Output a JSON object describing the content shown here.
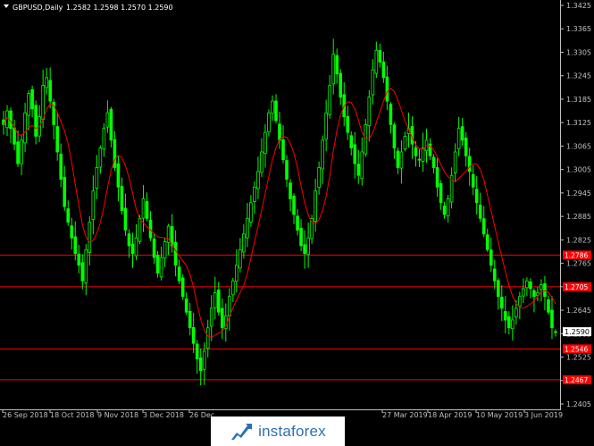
{
  "header": {
    "symbol_timeframe": "GBPUSD,Daily",
    "ohlc": "1.2582 1.2598 1.2570 1.2590"
  },
  "colors": {
    "background": "#000000",
    "candle": "#00ff00",
    "moving_average": "#ff0000",
    "level_line": "#ff0000",
    "axis_text": "#c0c0c0"
  },
  "chart_data": {
    "type": "candlestick",
    "title": "GBPUSD,Daily",
    "grid": false,
    "y_ticks": [
      "1.3425",
      "1.3365",
      "1.3305",
      "1.3245",
      "1.3185",
      "1.3125",
      "1.3065",
      "1.3005",
      "1.2945",
      "1.2885",
      "1.2825",
      "1.2765",
      "1.2705",
      "1.2645",
      "1.2585",
      "1.2525",
      "1.2465",
      "1.2405"
    ],
    "x_ticks": [
      "26 Sep 2018",
      "18 Oct 2018",
      "9 Nov 2018",
      "3 Dec 2018",
      "26 Dec",
      "27 Mar 2019",
      "18 Apr 2019",
      "10 May 2019",
      "3 Jun 2019"
    ],
    "ylim": [
      1.2405,
      1.3425
    ],
    "levels": [
      {
        "label": "1.2786",
        "value": 1.2786
      },
      {
        "label": "1.2705",
        "value": 1.2705
      },
      {
        "label": "1.2546",
        "value": 1.2546
      },
      {
        "label": "1.2467",
        "value": 1.2467
      }
    ],
    "current_price": {
      "label": "1.2590",
      "value": 1.259
    },
    "series": [
      {
        "kind": "ohlc",
        "close": [
          1.312,
          1.3155,
          1.311,
          1.307,
          1.302,
          1.308,
          1.315,
          1.32,
          1.316,
          1.309,
          1.314,
          1.322,
          1.324,
          1.318,
          1.312,
          1.305,
          1.298,
          1.291,
          1.287,
          1.283,
          1.279,
          1.276,
          1.272,
          1.28,
          1.287,
          1.295,
          1.301,
          1.306,
          1.311,
          1.315,
          1.308,
          1.301,
          1.296,
          1.29,
          1.285,
          1.281,
          1.279,
          1.283,
          1.288,
          1.293,
          1.288,
          1.283,
          1.278,
          1.274,
          1.278,
          1.282,
          1.286,
          1.281,
          1.276,
          1.272,
          1.268,
          1.264,
          1.26,
          1.256,
          1.252,
          1.249,
          1.254,
          1.26,
          1.265,
          1.269,
          1.264,
          1.26,
          1.263,
          1.268,
          1.272,
          1.276,
          1.28,
          1.284,
          1.288,
          1.292,
          1.296,
          1.3,
          1.305,
          1.31,
          1.315,
          1.318,
          1.313,
          1.308,
          1.303,
          1.298,
          1.293,
          1.289,
          1.285,
          1.281,
          1.279,
          1.283,
          1.288,
          1.295,
          1.301,
          1.308,
          1.315,
          1.322,
          1.33,
          1.325,
          1.319,
          1.314,
          1.31,
          1.306,
          1.302,
          1.299,
          1.305,
          1.312,
          1.319,
          1.326,
          1.331,
          1.328,
          1.324,
          1.318,
          1.312,
          1.306,
          1.301,
          1.305,
          1.309,
          1.311,
          1.307,
          1.304,
          1.303,
          1.306,
          1.308,
          1.304,
          1.301,
          1.296,
          1.292,
          1.289,
          1.293,
          1.299,
          1.305,
          1.311,
          1.308,
          1.304,
          1.3,
          1.296,
          1.292,
          1.288,
          1.284,
          1.28,
          1.276,
          1.272,
          1.268,
          1.265,
          1.262,
          1.26,
          1.262,
          1.265,
          1.268,
          1.27,
          1.272,
          1.27,
          1.268,
          1.269,
          1.271,
          1.268,
          1.264,
          1.26,
          1.259
        ]
      },
      {
        "kind": "moving_average",
        "name": ""
      }
    ]
  },
  "watermark": {
    "text": "instaforex",
    "icon": "instaforex-logo-icon"
  }
}
